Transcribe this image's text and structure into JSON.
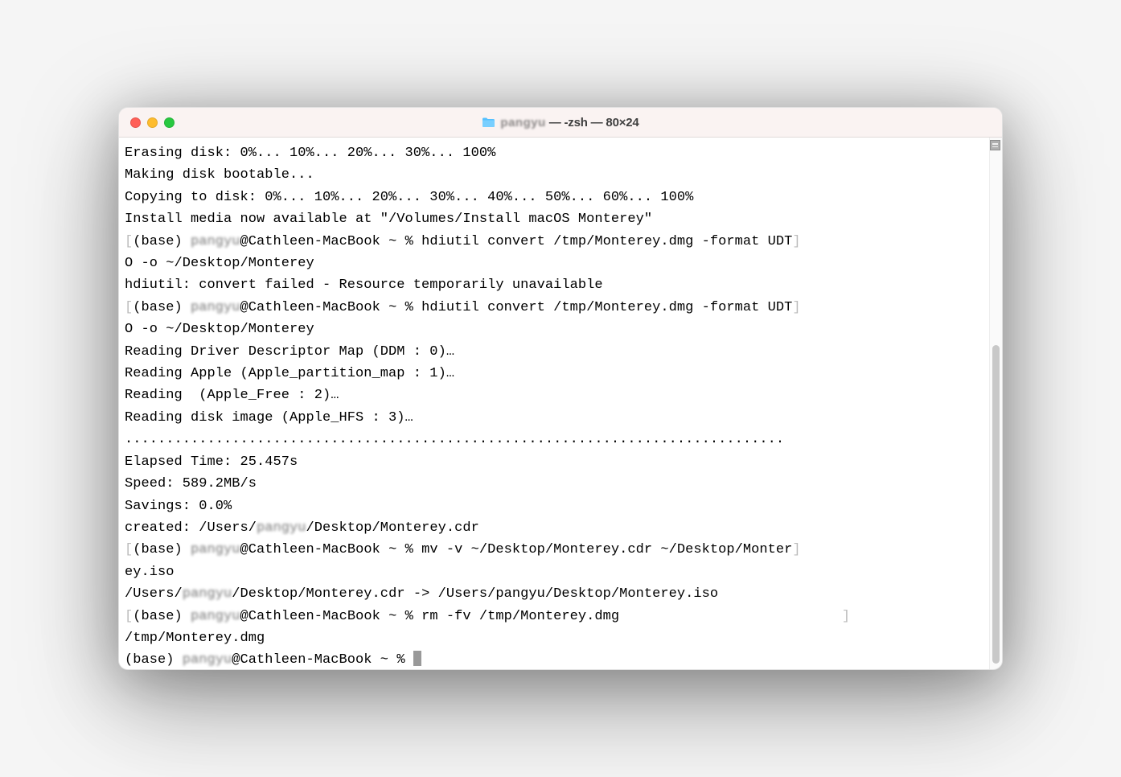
{
  "window": {
    "title_prefix_hidden": "pangyu",
    "title_suffix": " — -zsh — 80×24"
  },
  "lines": {
    "l1": "Erasing disk: 0%... 10%... 20%... 30%... 100%",
    "l2": "Making disk bootable...",
    "l3": "Copying to disk: 0%... 10%... 20%... 30%... 40%... 50%... 60%... 100%",
    "l4": "Install media now available at \"/Volumes/Install macOS Monterey\"",
    "l5a": "(base) ",
    "l5b": "pangyu",
    "l5c": "@Cathleen-MacBook ~ % hdiutil convert /tmp/Monterey.dmg -format UDT",
    "l6": "O -o ~/Desktop/Monterey",
    "l7": "hdiutil: convert failed - Resource temporarily unavailable",
    "l8a": "(base) ",
    "l8b": "pangyu",
    "l8c": "@Cathleen-MacBook ~ % hdiutil convert /tmp/Monterey.dmg -format UDT",
    "l9": "O -o ~/Desktop/Monterey",
    "l10": "Reading Driver Descriptor Map (DDM : 0)…",
    "l11": "Reading Apple (Apple_partition_map : 1)…",
    "l12": "Reading  (Apple_Free : 2)…",
    "l13": "Reading disk image (Apple_HFS : 3)…",
    "l14": "................................................................................",
    "l15": "Elapsed Time: 25.457s",
    "l16": "Speed: 589.2MB/s",
    "l17": "Savings: 0.0%",
    "l18a": "created: /Users/",
    "l18b": "pangyu",
    "l18c": "/Desktop/Monterey.cdr",
    "l19a": "(base) ",
    "l19b": "pangyu",
    "l19c": "@Cathleen-MacBook ~ % mv -v ~/Desktop/Monterey.cdr ~/Desktop/Monter",
    "l20": "ey.iso",
    "l21a": "/Users/",
    "l21b": "pangyu",
    "l21c": "/Desktop/Monterey.cdr -> /Users/pangyu/Desktop/Monterey.iso",
    "l22a": "(base) ",
    "l22b": "pangyu",
    "l22c": "@Cathleen-MacBook ~ % rm -fv /tmp/Monterey.dmg",
    "l23": "/tmp/Monterey.dmg",
    "l24a": "(base) ",
    "l24b": "pangyu",
    "l24c": "@Cathleen-MacBook ~ % "
  }
}
